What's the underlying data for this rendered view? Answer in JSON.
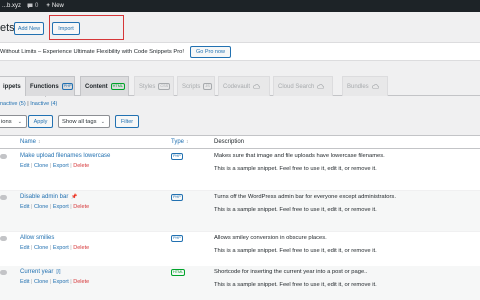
{
  "adminbar": {
    "site": "...b.xyz",
    "comments_count": "0",
    "new_label": "New"
  },
  "header": {
    "title": "ets",
    "add_new": "Add New",
    "import": "Import"
  },
  "promo": {
    "text": "Without Limits – Experience Ultimate Flexibility with Code Snippets Pro!",
    "button": "Go Pro now"
  },
  "tabs": [
    {
      "label": "ippets"
    },
    {
      "label": "Functions",
      "badge": "PHP"
    },
    {
      "label": "Content",
      "badge": "HTML"
    },
    {
      "label": "Styles",
      "badge": "CSS"
    },
    {
      "label": "Scripts",
      "badge": "JS"
    },
    {
      "label": "Codevault"
    },
    {
      "label": "Cloud Search"
    },
    {
      "label": "Bundles"
    }
  ],
  "views": {
    "inactive": "nactive (5)",
    "sep": "|",
    "inactive2": "Inactive (4)"
  },
  "filters": {
    "bulk": "ions",
    "apply": "Apply",
    "tags": "Show all tags",
    "filter": "Filter"
  },
  "table": {
    "columns": {
      "name": "Name",
      "type": "Type",
      "description": "Description"
    },
    "actions": {
      "edit": "Edit",
      "clone": "Clone",
      "export": "Export",
      "delete": "Delete",
      "sep": "|"
    },
    "rows": [
      {
        "name": "Make upload filenames lowercase",
        "type": "PHP",
        "desc": "Makes sure that image and file uploads have lowercase filenames.",
        "note": "This is a sample snippet. Feel free to use it, edit it, or remove it."
      },
      {
        "name": "Disable admin bar",
        "type": "PHP",
        "desc": "Turns off the WordPress admin bar for everyone except administrators.",
        "note": "This is a sample snippet. Feel free to use it, edit it, or remove it."
      },
      {
        "name": "Allow smilies",
        "type": "PHP",
        "desc": "Allows smiley conversion in obscure places.",
        "note": "This is a sample snippet. Feel free to use it, edit it, or remove it."
      },
      {
        "name": "Current year",
        "type": "HTML",
        "desc": "Shortcode for inserting the current year into a post or page..",
        "note": "This is a sample snippet. Feel free to use it, edit it, or remove it."
      }
    ]
  }
}
